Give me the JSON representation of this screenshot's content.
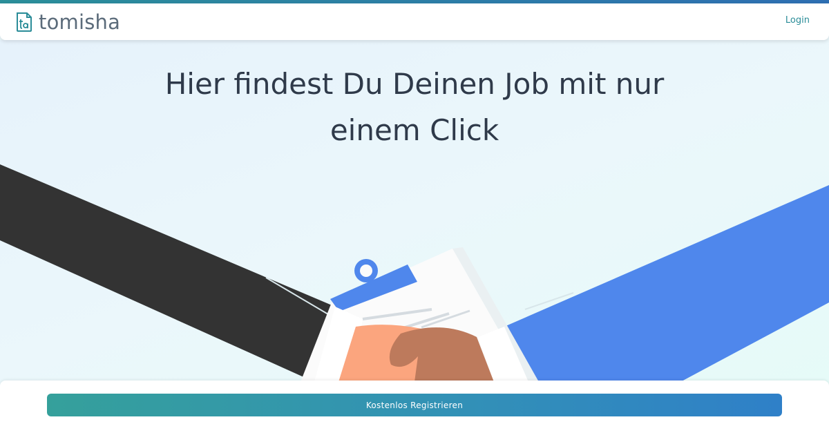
{
  "brand": {
    "name": "tomisha",
    "accent_color": "#2a8c98"
  },
  "nav": {
    "login_label": "Login"
  },
  "hero": {
    "title_line1": "Hier findest Du Deinen Job mit nur",
    "title_line2": "einem Click"
  },
  "cta": {
    "register_label": "Kostenlos Registrieren",
    "gradient_start": "#35a09b",
    "gradient_end": "#2f80c8"
  }
}
